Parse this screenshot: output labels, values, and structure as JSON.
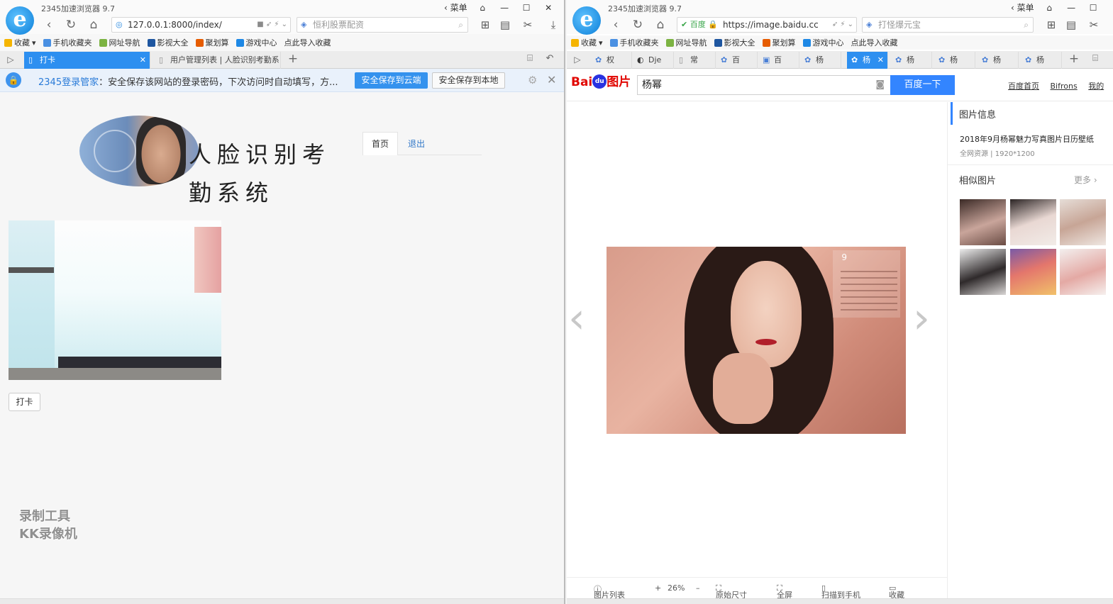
{
  "left": {
    "title": "2345加速浏览器 9.7",
    "menu": "菜单",
    "url": "127.0.0.1:8000/index/",
    "search_placeholder": "恒利股票配资",
    "favs": [
      "收藏",
      "手机收藏夹",
      "网址导航",
      "影视大全",
      "聚划算",
      "游戏中心",
      "点此导入收藏"
    ],
    "tab_active": "打卡",
    "tab2": "用户管理列表 | 人脸识别考勤系",
    "info_brand": "2345登录管家",
    "info_text": "：安全保存该网站的登录密码，下次访问时自动填写，方...",
    "btn_cloud": "安全保存到云端",
    "btn_local": "安全保存到本地",
    "sys_title": "人脸识别考勤系统",
    "nav_home": "首页",
    "nav_exit": "退出",
    "punch_btn": "打卡",
    "watermark_1": "录制工具",
    "watermark_2": "KK录像机"
  },
  "right": {
    "title": "2345加速浏览器 9.7",
    "menu": "菜单",
    "site_badge": "百度",
    "url": "https://image.baidu.cc",
    "search_placeholder": "打怪爆元宝",
    "favs": [
      "收藏",
      "手机收藏夹",
      "网址导航",
      "影视大全",
      "聚划算",
      "游戏中心",
      "点此导入收藏"
    ],
    "tabs": [
      "权",
      "Dje",
      "常",
      "百",
      "百",
      "杨",
      "杨",
      "杨",
      "杨",
      "杨",
      "杨"
    ],
    "baidu_logo_text": "Bai",
    "baidu_logo_du": "du",
    "baidu_logo_suffix": "图片",
    "query": "杨幂",
    "search_btn": "百度一下",
    "link_home": "百度首页",
    "link_user": "Bifrons",
    "link_mine": "我的",
    "info_heading": "图片信息",
    "info_desc": "2018年9月杨幂魅力写真图片日历壁纸",
    "info_meta": "全网资源  |  1920*1200",
    "similar_heading": "相似图片",
    "more": "更多",
    "cal_month": "9",
    "toolbar": {
      "list": "图片列表",
      "zoom": "26%",
      "original": "原始尺寸",
      "fullscreen": "全屏",
      "scan": "扫描到手机",
      "favorite": "收藏"
    }
  },
  "colors": {
    "accent": "#2d8ff0",
    "baidu_blue": "#3385ff",
    "baidu_red": "#e10601"
  }
}
